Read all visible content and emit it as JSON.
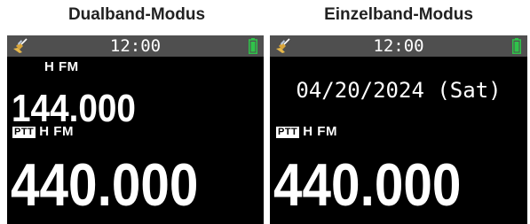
{
  "captions": {
    "dual": "Dualband-Modus",
    "single": "Einzelband-Modus"
  },
  "colors": {
    "screen_background": "#000000",
    "statusbar_background": "#4f4f4f",
    "battery": "#2fc34a",
    "gps": "#e7b84a",
    "text": "#ffffff"
  },
  "icons": {
    "gps": "gps-satellite-icon",
    "battery": "battery-icon",
    "ptt": "ptt-badge"
  },
  "dual_screen": {
    "clock": "12:00",
    "band_a": {
      "mode": "H FM",
      "frequency": "144.000"
    },
    "band_b": {
      "ptt_label": "PTT",
      "mode": "H FM",
      "frequency": "440.000"
    }
  },
  "single_screen": {
    "clock": "12:00",
    "date": "04/20/2024 (Sat)",
    "band": {
      "ptt_label": "PTT",
      "mode": "H FM",
      "frequency": "440.000"
    }
  }
}
